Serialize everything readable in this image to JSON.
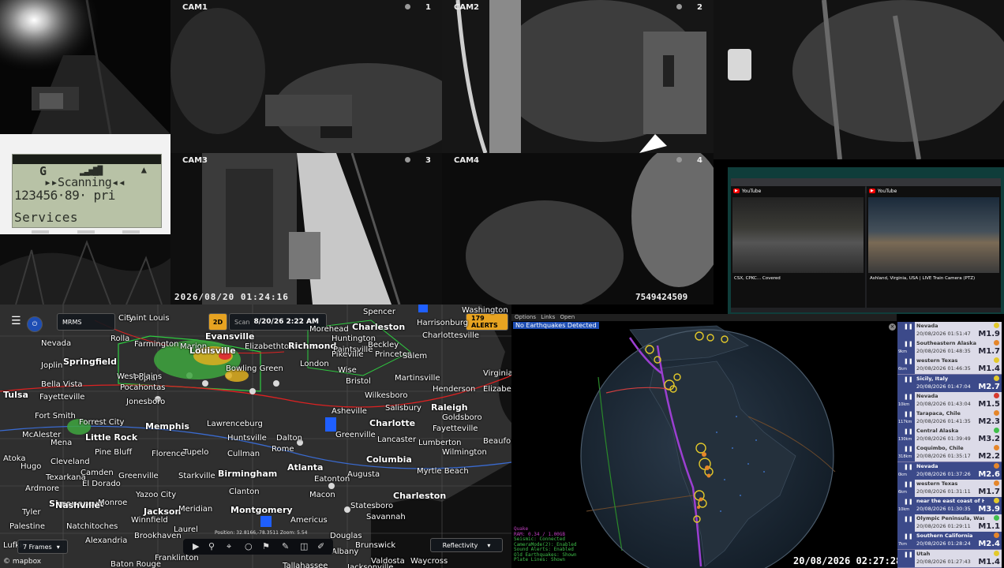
{
  "cameras": {
    "cam1": {
      "label": "CAM1",
      "number": "1"
    },
    "cam2": {
      "label": "CAM2",
      "number": "2"
    },
    "cam3": {
      "label": "CAM3",
      "number": "3"
    },
    "cam4": {
      "label": "CAM4",
      "number": "4"
    },
    "timestamp": "2026/08/20 01:24:16",
    "device_id": "7549424509"
  },
  "scanner": {
    "line1": "G",
    "signal": "▂▃▅▇█",
    "line2": "▸▸Scanning◂◂",
    "line3": "123456·89·  pri",
    "line4": "Services"
  },
  "youtube": {
    "left_title": "CSX, CPKC... Covered",
    "right_title": "Ashland, Virginia, USA | LIVE Train Camera (PTZ)"
  },
  "weather_map": {
    "product": "MRMS",
    "date_label": "Scan",
    "date": "8/20/26 2:22 AM",
    "zoom_badge": "2D",
    "alerts": "179 ALERTS",
    "frames": "7 Frames",
    "layer": "Reflectivity",
    "position": "Position: 32.8166,-78.3511  Zoom: 5.54",
    "attribution": "© mapbox",
    "cities": [
      {
        "name": "Saint Louis"
      },
      {
        "name": "City"
      },
      {
        "name": "Evansville"
      },
      {
        "name": "Charleston"
      },
      {
        "name": "Harrisonburg"
      },
      {
        "name": "Washington"
      },
      {
        "name": "Marion"
      },
      {
        "name": "Farmington"
      },
      {
        "name": "Springfield"
      },
      {
        "name": "Louisville"
      },
      {
        "name": "Elizabethtown"
      },
      {
        "name": "Richmond"
      },
      {
        "name": "Charlottesville"
      },
      {
        "name": "Huntington"
      },
      {
        "name": "Paintsville"
      },
      {
        "name": "Beckley"
      },
      {
        "name": "Pikeville"
      },
      {
        "name": "Princeton"
      },
      {
        "name": "Salem"
      },
      {
        "name": "Rolla"
      },
      {
        "name": "Nevada"
      },
      {
        "name": "Joplin"
      },
      {
        "name": "Bowling Green"
      },
      {
        "name": "London"
      },
      {
        "name": "Wise"
      },
      {
        "name": "Martinsville"
      },
      {
        "name": "Virginia"
      },
      {
        "name": "Bella Vista"
      },
      {
        "name": "Tulsa"
      },
      {
        "name": "Fayetteville"
      },
      {
        "name": "Poplar"
      },
      {
        "name": "Jonesboro"
      },
      {
        "name": "Bristol"
      },
      {
        "name": "Henderson"
      },
      {
        "name": "Elizabeth"
      },
      {
        "name": "Wilkesboro"
      },
      {
        "name": "Salisbury"
      },
      {
        "name": "Raleigh"
      },
      {
        "name": "Goldsboro"
      },
      {
        "name": "Fayetteville"
      },
      {
        "name": "Greenville"
      },
      {
        "name": "Charlotte"
      },
      {
        "name": "Lancaster"
      },
      {
        "name": "Lumberton"
      },
      {
        "name": "Wilmington"
      },
      {
        "name": "Memphis"
      },
      {
        "name": "Little Rock"
      },
      {
        "name": "Lawrenceburg"
      },
      {
        "name": "Huntsville"
      },
      {
        "name": "Asheville"
      },
      {
        "name": "Florence"
      },
      {
        "name": "Pine Bluff"
      },
      {
        "name": "Tupelo"
      },
      {
        "name": "Cullman"
      },
      {
        "name": "Dalton"
      },
      {
        "name": "Rome"
      },
      {
        "name": "Atlanta"
      },
      {
        "name": "Columbia"
      },
      {
        "name": "Myrtle Beach"
      },
      {
        "name": "Camden"
      },
      {
        "name": "El Dorado"
      },
      {
        "name": "Greenville"
      },
      {
        "name": "Starkville"
      },
      {
        "name": "Birmingham"
      },
      {
        "name": "Augusta"
      },
      {
        "name": "Charleston"
      },
      {
        "name": "Texarkana"
      },
      {
        "name": "Hugo"
      },
      {
        "name": "Atoka"
      },
      {
        "name": "Shreveport"
      },
      {
        "name": "Monroe"
      },
      {
        "name": "Yazoo City"
      },
      {
        "name": "Jackson"
      },
      {
        "name": "Meridian"
      },
      {
        "name": "Montgomery"
      },
      {
        "name": "Macon"
      },
      {
        "name": "Statesboro"
      },
      {
        "name": "Savannah"
      },
      {
        "name": "Tyler"
      },
      {
        "name": "Palestine"
      },
      {
        "name": "Natchitoches"
      },
      {
        "name": "Alexandria"
      },
      {
        "name": "Laurel"
      },
      {
        "name": "Americus"
      },
      {
        "name": "Douglas"
      },
      {
        "name": "Brunswick"
      },
      {
        "name": "Baton Rouge"
      },
      {
        "name": "Franklinton"
      },
      {
        "name": "Tallahassee"
      },
      {
        "name": "Jacksonville"
      },
      {
        "name": "Eatonton"
      },
      {
        "name": "Clanton"
      },
      {
        "name": "Pocahontas"
      },
      {
        "name": "West Plains"
      },
      {
        "name": "Morehead"
      },
      {
        "name": "Spencer"
      },
      {
        "name": "Nashville"
      },
      {
        "name": "Forrest City"
      },
      {
        "name": "Fort Smith"
      },
      {
        "name": "Mena"
      },
      {
        "name": "McAlester"
      },
      {
        "name": "Cleveland"
      },
      {
        "name": "Beaufort"
      },
      {
        "name": "Ardmore"
      },
      {
        "name": "Brookhaven"
      },
      {
        "name": "Lufkin"
      },
      {
        "name": "Winnfield"
      },
      {
        "name": "Albany"
      },
      {
        "name": "Valdosta"
      },
      {
        "name": "Waycross"
      }
    ]
  },
  "earthquakes": {
    "menu": [
      "Options",
      "Links",
      "Open"
    ],
    "status": "No Earthquakes Detected",
    "clock": "20/08/2026 02:27:28",
    "stats": [
      "Quake",
      "RAM: 0.34 / 1.00GB",
      "Seismic: Connected",
      "CameraMode(2): Enabled",
      "Sound Alerts: Enabled",
      "Old Earthquakes: Shown",
      "Plate Lines: Shown"
    ],
    "list": [
      {
        "place": "Nevada",
        "time": "20/08/2026 01:51:47",
        "mag": "M1.9",
        "depth": "",
        "color": "#e3c92a",
        "hi": false
      },
      {
        "place": "Southeastern Alaska",
        "time": "20/08/2026 01:48:35",
        "mag": "M1.7",
        "depth": "9km",
        "color": "#e5862a",
        "hi": false
      },
      {
        "place": "western Texas",
        "time": "20/08/2026 01:46:35",
        "mag": "M1.4",
        "depth": "6km",
        "color": "#e3c92a",
        "hi": false
      },
      {
        "place": "Sicily, Italy",
        "time": "20/08/2026 01:47:04",
        "mag": "M2.7",
        "depth": "",
        "color": "#e3c92a",
        "hi": true
      },
      {
        "place": "Nevada",
        "time": "20/08/2026 01:43:04",
        "mag": "M1.5",
        "depth": "10km",
        "color": "#d83b2f",
        "hi": false
      },
      {
        "place": "Tarapaca, Chile",
        "time": "20/08/2026 01:41:35",
        "mag": "M2.3",
        "depth": "117km",
        "color": "#e5862a",
        "hi": false
      },
      {
        "place": "Central Alaska",
        "time": "20/08/2026 01:39:49",
        "mag": "M3.2",
        "depth": "130km",
        "color": "#3fbf4a",
        "hi": false
      },
      {
        "place": "Coquimbo, Chile",
        "time": "20/08/2026 01:35:17",
        "mag": "M2.2",
        "depth": "318km",
        "color": "#e5862a",
        "hi": false
      },
      {
        "place": "Nevada",
        "time": "20/08/2026 01:37:26",
        "mag": "M2.6",
        "depth": "0km",
        "color": "#e5862a",
        "hi": true
      },
      {
        "place": "western Texas",
        "time": "20/08/2026 01:31:11",
        "mag": "M1.7",
        "depth": "6km",
        "color": "#e5862a",
        "hi": false
      },
      {
        "place": "near the east coast of Hon...",
        "time": "20/08/2026 01:30:35",
        "mag": "M3.9",
        "depth": "10km",
        "color": "#e3c92a",
        "hi": true
      },
      {
        "place": "Olympic Peninsula, Washin...",
        "time": "20/08/2026 01:29:11",
        "mag": "M1.1",
        "depth": "",
        "color": "#3fbf4a",
        "hi": false
      },
      {
        "place": "Southern California",
        "time": "20/08/2026 01:28:24",
        "mag": "M2.4",
        "depth": "7km",
        "color": "#e5862a",
        "hi": true
      },
      {
        "place": "Utah",
        "time": "20/08/2026 01:27:43",
        "mag": "M1.4",
        "depth": "",
        "color": "#e3c92a",
        "hi": false
      }
    ]
  }
}
